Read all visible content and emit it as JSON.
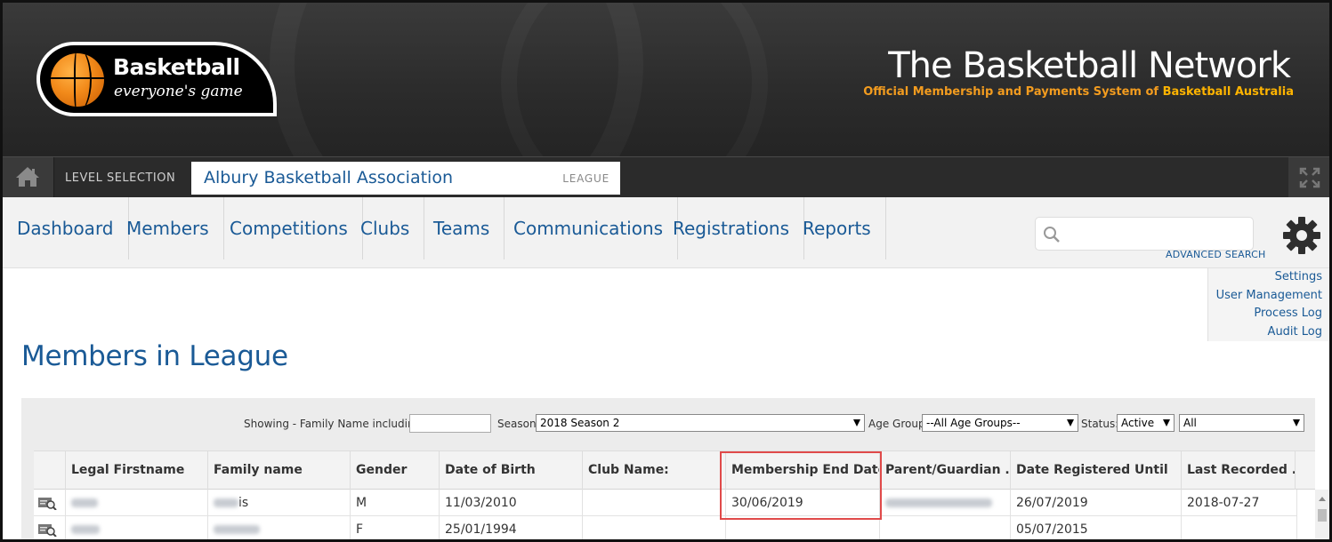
{
  "header": {
    "logo_title": "Basketball",
    "logo_sub": "everyone's game",
    "network_title": "The Basketball Network",
    "network_sub_prefix": "Official Membership and Payments System of ",
    "network_sub_brand": "Basketball Australia"
  },
  "level": {
    "label": "LEVEL SELECTION",
    "name": "Albury Basketball Association",
    "type": "LEAGUE"
  },
  "nav": {
    "items": [
      "Dashboard",
      "Members",
      "Competitions",
      "Clubs",
      "Teams",
      "Communications",
      "Registrations",
      "Reports"
    ],
    "search_placeholder": "",
    "advanced_search": "ADVANCED SEARCH"
  },
  "settings_menu": [
    "Settings",
    "User Management",
    "Process Log",
    "Audit Log"
  ],
  "page_title": "Members in League",
  "filters": {
    "showing_label": "Showing - Family Name including",
    "family_name_value": "",
    "season_label": "Season",
    "season_value": "2018 Season 2",
    "age_group_label": "Age Group",
    "age_group_value": "--All Age Groups--",
    "status_label": "Status:",
    "status_value": "Active",
    "extra_value": "All"
  },
  "grid": {
    "columns": [
      "Legal Firstname",
      "Family name",
      "Gender",
      "Date of Birth",
      "Club Name:",
      "Membership End Date",
      "Parent/Guardian ...",
      "Date Registered Until",
      "Last Recorded ..."
    ],
    "rows": [
      {
        "family_suffix": "is",
        "gender": "M",
        "dob": "11/03/2010",
        "club": "",
        "membership_end": "30/06/2019",
        "registered_until": "26/07/2019",
        "last_recorded": "2018-07-27"
      },
      {
        "family_suffix": "",
        "gender": "F",
        "dob": "25/01/1994",
        "club": "",
        "membership_end": "",
        "registered_until": "05/07/2015",
        "last_recorded": ""
      }
    ]
  },
  "colors": {
    "brand_blue": "#1a5a96",
    "header_dark": "#2c2c2c",
    "accent_orange": "#f39c1f",
    "highlight_red": "#e04a4a"
  }
}
